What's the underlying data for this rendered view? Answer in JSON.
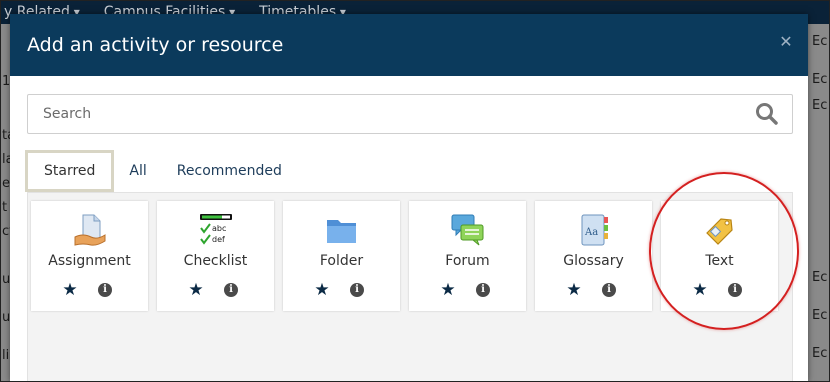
{
  "background": {
    "nav_items": [
      "y Related",
      "Campus Facilities",
      "Timetables"
    ],
    "right_fragments": [
      "Ec",
      "Ec",
      "Ec",
      "Ec",
      "Ec",
      "Ec"
    ],
    "left_fragments": [
      "1",
      "ta",
      "la",
      "ea",
      "t",
      "ct",
      "ut",
      "ul",
      "lis"
    ]
  },
  "modal": {
    "title": "Add an activity or resource",
    "close_icon": "close-icon",
    "search": {
      "placeholder": "Search",
      "value": ""
    },
    "tabs": [
      {
        "label": "Starred",
        "active": true
      },
      {
        "label": "All",
        "active": false
      },
      {
        "label": "Recommended",
        "active": false
      }
    ],
    "cards": [
      {
        "label": "Assignment",
        "icon": "assignment-icon",
        "starred": true
      },
      {
        "label": "Checklist",
        "icon": "checklist-icon",
        "starred": true
      },
      {
        "label": "Folder",
        "icon": "folder-icon",
        "starred": true
      },
      {
        "label": "Forum",
        "icon": "forum-icon",
        "starred": true
      },
      {
        "label": "Glossary",
        "icon": "glossary-icon",
        "starred": true
      },
      {
        "label": "Text",
        "icon": "text-label-icon",
        "starred": true
      }
    ],
    "checklist_icon_text": [
      "abc",
      "def"
    ],
    "glossary_icon_text": "Aa"
  },
  "colors": {
    "header_bg": "#0b3a5c",
    "nav_bg": "#0a2238",
    "highlight": "#d42020",
    "star": "#0b2a45"
  }
}
